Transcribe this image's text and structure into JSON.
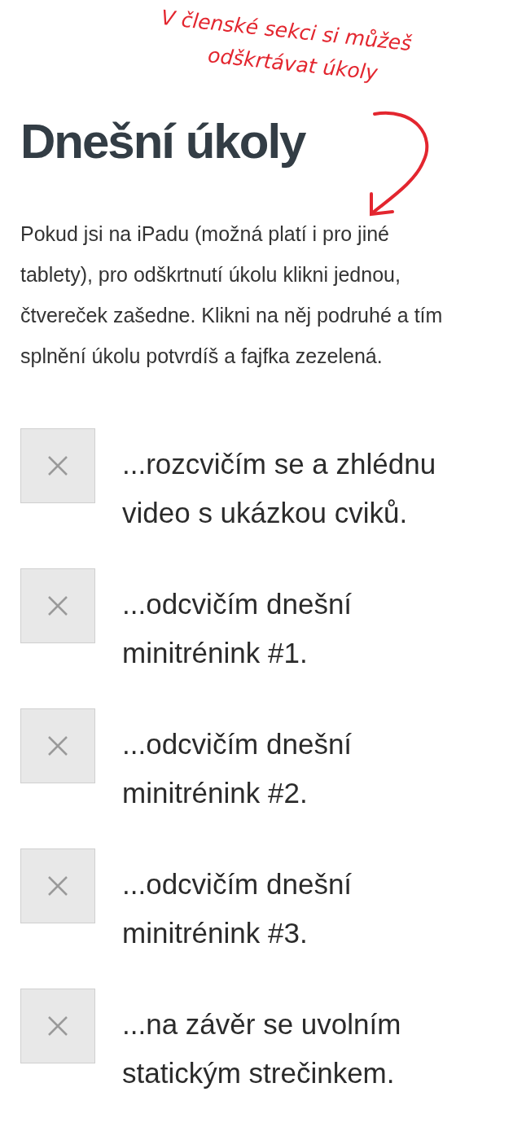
{
  "annotation": {
    "lines": [
      "V členské sekci si můžeš",
      "odškrtávat úkoly"
    ]
  },
  "title": "Dnešní úkoly",
  "intro": "Pokud jsi na iPadu (možná platí i pro jiné tablety), pro odškrtnutí úkolu klikni jednou, čtvereček zašedne. Klikni na něj podruhé a tím splnění úkolu potvrdíš a fajfka zezelená.",
  "tasks": [
    {
      "label": "...rozcvičím se a zhlédnu video s ukázkou cviků.",
      "checked": false
    },
    {
      "label": "...odcvičím dnešní minitrénink #1.",
      "checked": false
    },
    {
      "label": "...odcvičím dnešní minitrénink #2.",
      "checked": false
    },
    {
      "label": "...odcvičím dnešní minitrénink #3.",
      "checked": false
    },
    {
      "label": "...na závěr se uvolním statickým strečinkem.",
      "checked": false
    }
  ]
}
